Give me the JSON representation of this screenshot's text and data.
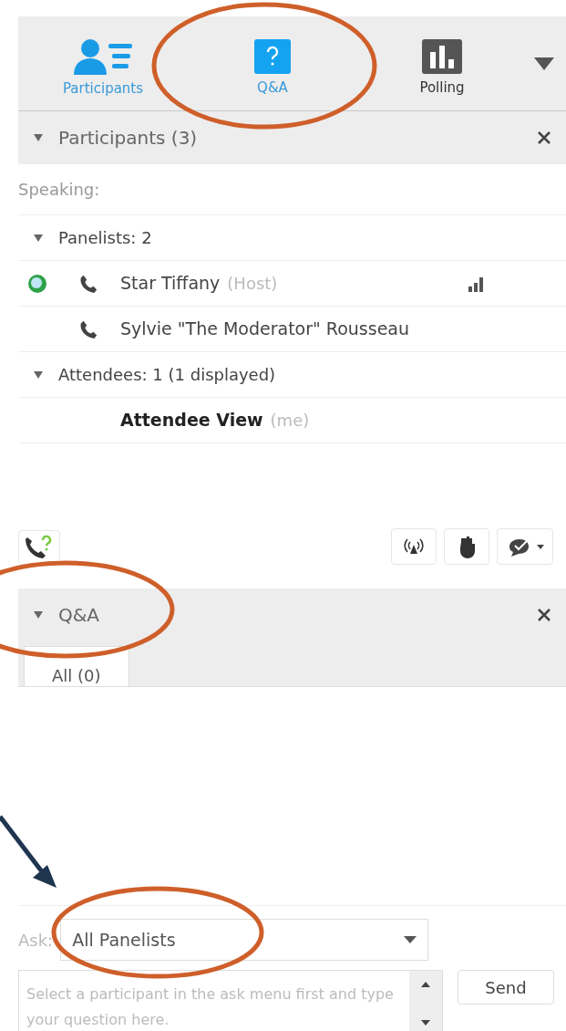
{
  "toolbar": {
    "tabs": [
      {
        "kind": "participants",
        "label": "Participants",
        "selected": true
      },
      {
        "kind": "qa",
        "label": "Q&A",
        "selected": true
      },
      {
        "kind": "polling",
        "label": "Polling",
        "selected": false
      }
    ]
  },
  "participants_panel": {
    "title": "Participants (3)",
    "expanded": true,
    "speaking": "Speaking:",
    "groups": [
      {
        "label": "Panelists: 2",
        "expanded": true,
        "children": [
          {
            "name": "Star Tiffany",
            "role": "(Host)",
            "phone": true,
            "status": true,
            "signal": true,
            "bold": false
          },
          {
            "name": "Sylvie \"The Moderator\" Rousseau",
            "phone": true,
            "status": false,
            "signal": false,
            "bold": false
          }
        ]
      },
      {
        "label": "Attendees: 1 (1 displayed)",
        "expanded": true,
        "children": [
          {
            "name": "Attendee View",
            "role": "(me)",
            "phone": false,
            "status": false,
            "signal": false,
            "bold": true
          }
        ]
      }
    ]
  },
  "qa_panel": {
    "title": "Q&A",
    "expanded": true,
    "tabs": [
      {
        "label": "All (0)",
        "selected": true
      }
    ],
    "ask_label": "Ask:",
    "ask_value": "All Panelists",
    "placeholder": "Select a participant in the ask menu first and type your question here.",
    "send": "Send"
  }
}
